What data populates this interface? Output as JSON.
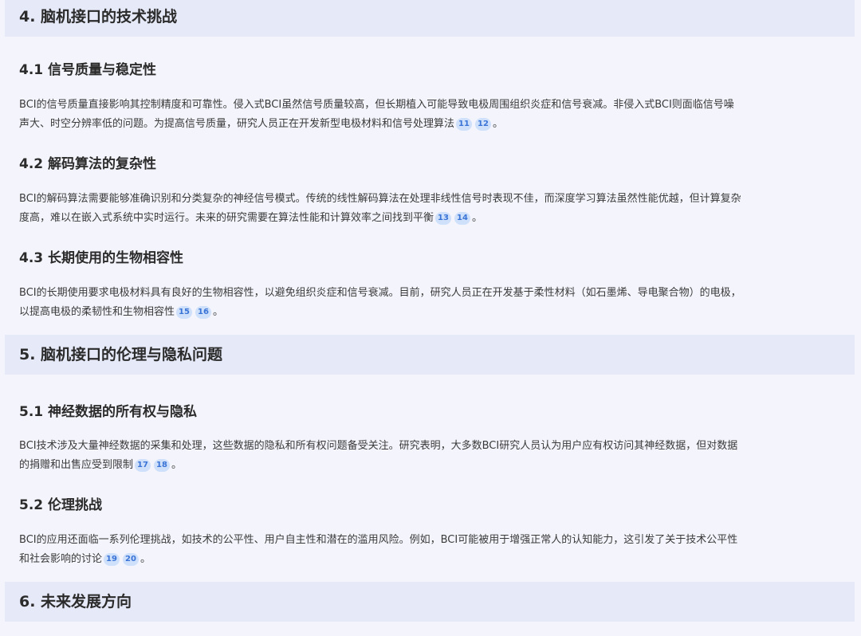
{
  "sections": [
    {
      "title": "4. 脑机接口的技术挑战",
      "subsections": [
        {
          "title": "4.1 信号质量与稳定性",
          "lines": [
            "BCI的信号质量直接影响其控制精度和可靠性。侵入式BCI虽然信号质量较高，但长期植入可能导致电极周围组织炎症和信号衰减。非侵入式BCI则面临信号噪",
            "声大、时空分辨率低的问题。为提高信号质量，研究人员正在开发新型电极材料和信号处理算法"
          ],
          "citations": [
            "11",
            "12"
          ]
        },
        {
          "title": "4.2 解码算法的复杂性",
          "lines": [
            "BCI的解码算法需要能够准确识别和分类复杂的神经信号模式。传统的线性解码算法在处理非线性信号时表现不佳，而深度学习算法虽然性能优越，但计算复杂",
            "度高，难以在嵌入式系统中实时运行。未来的研究需要在算法性能和计算效率之间找到平衡"
          ],
          "citations": [
            "13",
            "14"
          ]
        },
        {
          "title": "4.3 长期使用的生物相容性",
          "lines": [
            "BCI的长期使用要求电极材料具有良好的生物相容性，以避免组织炎症和信号衰减。目前，研究人员正在开发基于柔性材料（如石墨烯、导电聚合物）的电极，",
            "以提高电极的柔韧性和生物相容性"
          ],
          "citations": [
            "15",
            "16"
          ]
        }
      ]
    },
    {
      "title": "5. 脑机接口的伦理与隐私问题",
      "subsections": [
        {
          "title": "5.1 神经数据的所有权与隐私",
          "lines": [
            "BCI技术涉及大量神经数据的采集和处理，这些数据的隐私和所有权问题备受关注。研究表明，大多数BCI研究人员认为用户应有权访问其神经数据，但对数据",
            "的捐赠和出售应受到限制"
          ],
          "citations": [
            "17",
            "18"
          ]
        },
        {
          "title": "5.2 伦理挑战",
          "lines": [
            "BCI的应用还面临一系列伦理挑战，如技术的公平性、用户自主性和潜在的滥用风险。例如，BCI可能被用于增强正常人的认知能力，这引发了关于技术公平性",
            "和社会影响的讨论"
          ],
          "citations": [
            "19",
            "20"
          ]
        }
      ]
    },
    {
      "title": "6. 未来发展方向",
      "subsections": []
    }
  ],
  "punctuation": {
    "end": "。"
  }
}
